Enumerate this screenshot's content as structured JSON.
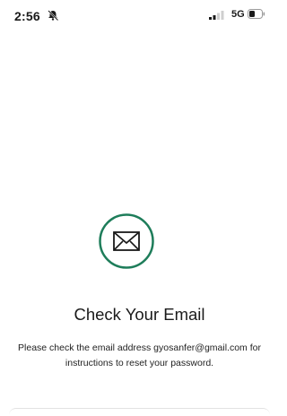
{
  "status_bar": {
    "time": "2:56",
    "network": "5G",
    "icons": [
      "bell-off-icon",
      "signal-icon",
      "battery-icon"
    ]
  },
  "screen": {
    "icon": "mail-icon",
    "accent_color": "#1e7d5a",
    "title": "Check Your Email",
    "message": "Please check the email address gyosanfer@gmail.com for instructions to reset your password."
  }
}
